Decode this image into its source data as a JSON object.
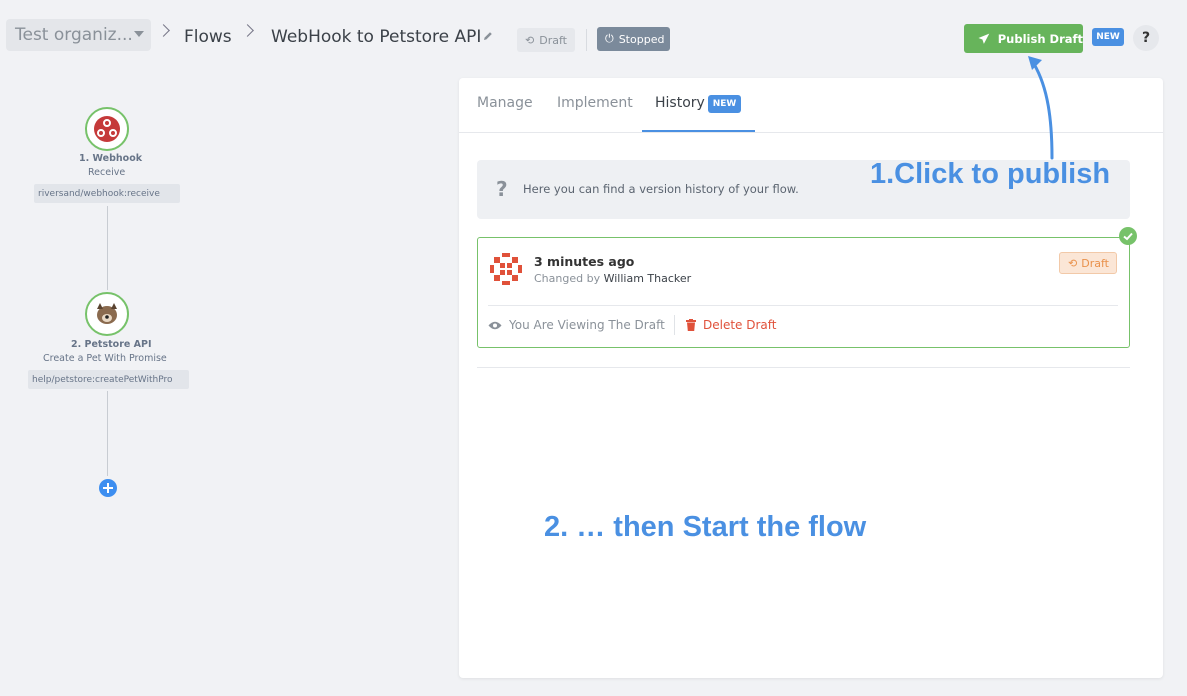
{
  "header": {
    "org_name": "Test organiz...",
    "breadcrumb": [
      "Flows",
      "WebHook to Petstore API"
    ],
    "draft_label": "Draft",
    "stopped_label": "Stopped",
    "publish_label": "Publish Draft",
    "new_badge": "NEW",
    "help_label": "?"
  },
  "flow": {
    "nodes": [
      {
        "title": "1. Webhook",
        "subtitle": "Receive",
        "tag": "riversand/webhook:receive",
        "icon": "webhook-icon"
      },
      {
        "title": "2. Petstore API",
        "subtitle": "Create a Pet With Promise",
        "tag": "help/petstore:createPetWithPro",
        "icon": "dog-avatar-icon"
      }
    ]
  },
  "tabs": {
    "manage": "Manage",
    "implement": "Implement",
    "history": "History",
    "history_badge": "NEW"
  },
  "history": {
    "info": "Here you can find a version history of your flow.",
    "entry": {
      "time": "3 minutes ago",
      "changed_by_prefix": "Changed by",
      "author": "William Thacker",
      "badge": "Draft",
      "viewing": "You Are Viewing The Draft",
      "delete": "Delete Draft"
    }
  },
  "annotations": {
    "step1": "1.Click to publish",
    "step2": "2. … then Start the flow"
  },
  "colors": {
    "accent": "#4a90e2",
    "publish": "#67b45b",
    "success": "#77c26a",
    "danger": "#e0513a",
    "stopped": "#7b8a9b"
  }
}
